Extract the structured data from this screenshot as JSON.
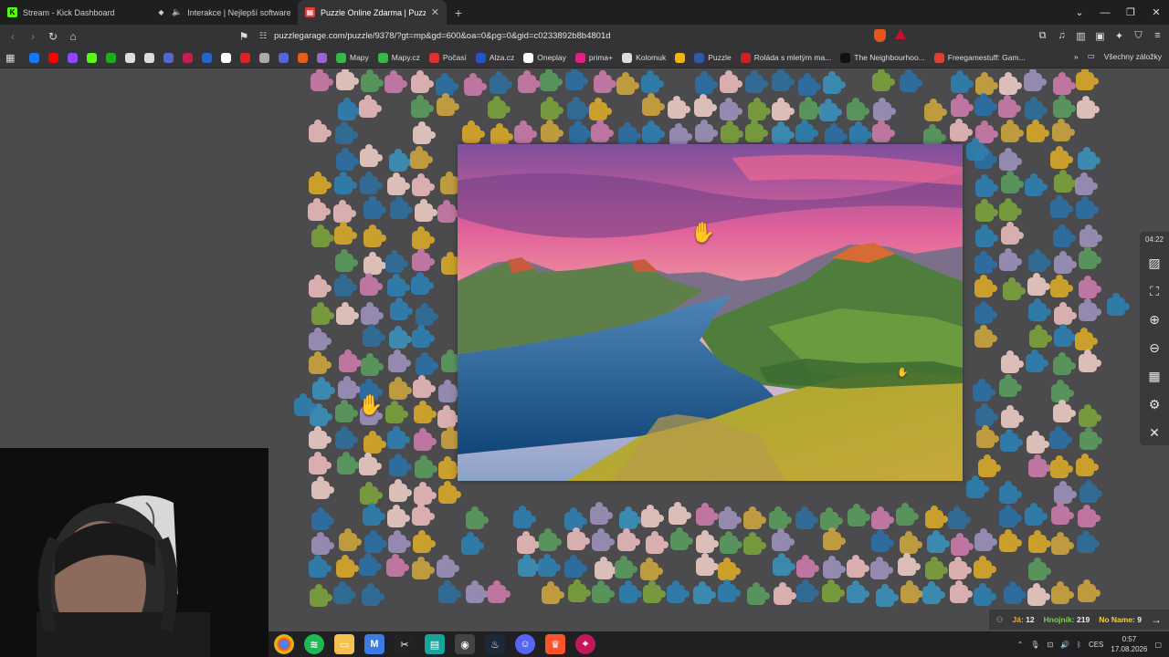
{
  "tabs": [
    {
      "title": "Stream - Kick Dashboard",
      "icon": "kick-icon",
      "color": "#53fc18"
    },
    {
      "title": "Interakce | Nejlepší software pro",
      "icon": "interakce-icon",
      "color": "#cccccc"
    },
    {
      "title": "Puzzle Online Zdarma | Puzzle G",
      "icon": "puzzle-icon",
      "color": "#e23b3b",
      "active": true
    }
  ],
  "address": {
    "url": "puzzlegarage.com/puzzle/9378/?gt=mp&gd=600&oa=0&pg=0&gid=c0233892b8b4801d"
  },
  "bookmarks": [
    {
      "label": "",
      "icon": "facebook-icon",
      "color": "#1877f2"
    },
    {
      "label": "",
      "icon": "youtube-icon",
      "color": "#ff0000"
    },
    {
      "label": "",
      "icon": "twitch-icon",
      "color": "#9146ff"
    },
    {
      "label": "",
      "icon": "kick-icon",
      "color": "#53fc18"
    },
    {
      "label": "",
      "icon": "stats-icon",
      "color": "#22aa22"
    },
    {
      "label": "",
      "icon": "anchor-icon",
      "color": "#dddddd"
    },
    {
      "label": "",
      "icon": "diamond-icon",
      "color": "#dddddd"
    },
    {
      "label": "",
      "icon": "ufo-icon",
      "color": "#5566cc"
    },
    {
      "label": "",
      "icon": "red-icon",
      "color": "#c02050"
    },
    {
      "label": "",
      "icon": "blue-icon",
      "color": "#2266cc"
    },
    {
      "label": "",
      "icon": "google-icon",
      "color": "#ffffff"
    },
    {
      "label": "",
      "icon": "adobe-icon",
      "color": "#dd2222"
    },
    {
      "label": "",
      "icon": "circle-icon",
      "color": "#aaaaaa"
    },
    {
      "label": "",
      "icon": "m-icon",
      "color": "#5566dd"
    },
    {
      "label": "",
      "icon": "at-icon",
      "color": "#e06020"
    },
    {
      "label": "",
      "icon": "play-icon",
      "color": "#9966cc"
    },
    {
      "label": "Mapy",
      "icon": "mapy-icon",
      "color": "#3ab54a"
    },
    {
      "label": "Mapy.cz",
      "icon": "mapycz-icon",
      "color": "#3ab54a"
    },
    {
      "label": "Počasí",
      "icon": "weather-icon",
      "color": "#dd3333"
    },
    {
      "label": "Alza.cz",
      "icon": "alza-icon",
      "color": "#2255cc"
    },
    {
      "label": "Oneplay",
      "icon": "oneplay-icon",
      "color": "#ffffff"
    },
    {
      "label": "prima+",
      "icon": "prima-icon",
      "color": "#dd2288"
    },
    {
      "label": "Kolomuk",
      "icon": "kolomuk-icon",
      "color": "#dddddd"
    },
    {
      "label": "",
      "icon": "chrome-color-icon",
      "color": "#f4b400"
    },
    {
      "label": "Puzzle",
      "icon": "puzzle-bm-icon",
      "color": "#3355aa"
    },
    {
      "label": "Roláda s mletým ma...",
      "icon": "recipe-icon",
      "color": "#cc2222"
    },
    {
      "label": "The Neighbourhoo...",
      "icon": "tn-icon",
      "color": "#111111"
    },
    {
      "label": "Freegamestuff: Gam...",
      "icon": "freegame-icon",
      "color": "#e04030"
    }
  ],
  "bookmarks_all": "Všechny záložky",
  "controls": {
    "timer": "04:22"
  },
  "scores": {
    "me_label": "Já:",
    "me_value": "12",
    "opp_label": "Hnojník:",
    "opp_value": "219",
    "nn_label": "No Name:",
    "nn_value": "9"
  },
  "tray": {
    "lang": "CES",
    "time": "0:57",
    "date": "17.08.2026"
  }
}
